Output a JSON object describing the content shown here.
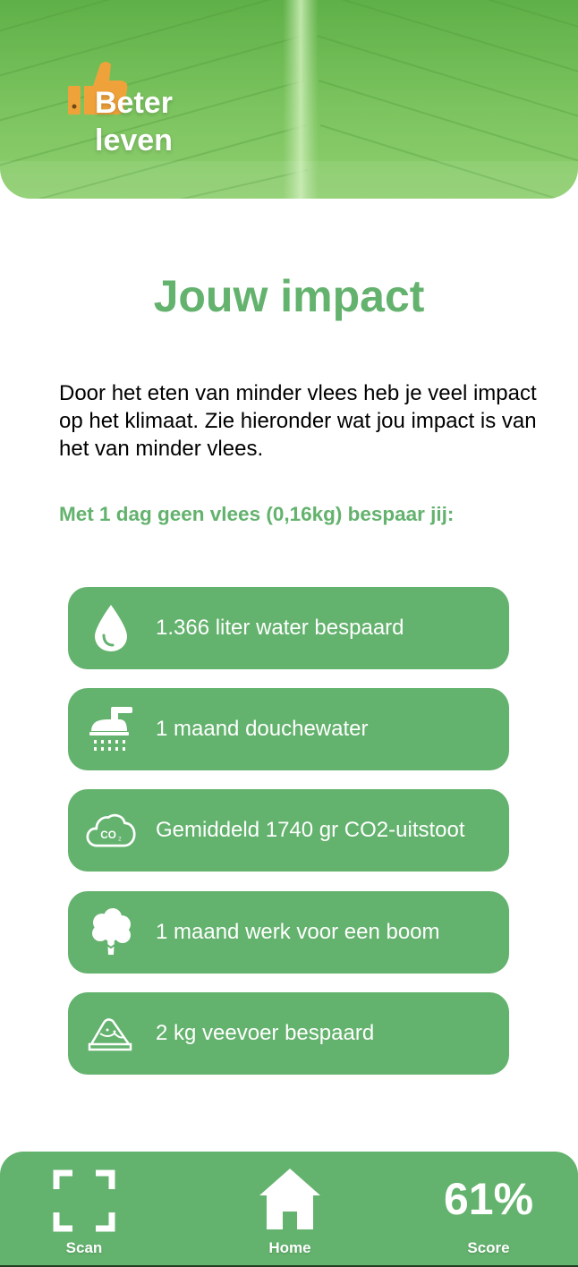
{
  "brand": {
    "line1": "Beter",
    "line2": "leven"
  },
  "page": {
    "title": "Jouw impact",
    "intro": "Door het eten van minder vlees heb je veel impact op het klimaat. Zie hieronder wat jou impact is van het van minder vlees.",
    "subhead": "Met 1 dag geen vlees (0,16kg) bespaar jij:"
  },
  "impacts": [
    {
      "icon": "water-drop-icon",
      "label": "1.366 liter water bespaard"
    },
    {
      "icon": "shower-icon",
      "label": "1 maand douchewater"
    },
    {
      "icon": "co2-cloud-icon",
      "label": "Gemiddeld 1740 gr CO2-uitstoot"
    },
    {
      "icon": "tree-icon",
      "label": "1 maand werk voor een boom"
    },
    {
      "icon": "feed-pile-icon",
      "label": "2 kg veevoer bespaard"
    }
  ],
  "nav": {
    "scan": "Scan",
    "home": "Home",
    "score_label": "Score",
    "score_value": "61%"
  },
  "colors": {
    "accent": "#63b26d",
    "header_green": "#6dbd52",
    "logo_orange": "#f0a23a"
  }
}
